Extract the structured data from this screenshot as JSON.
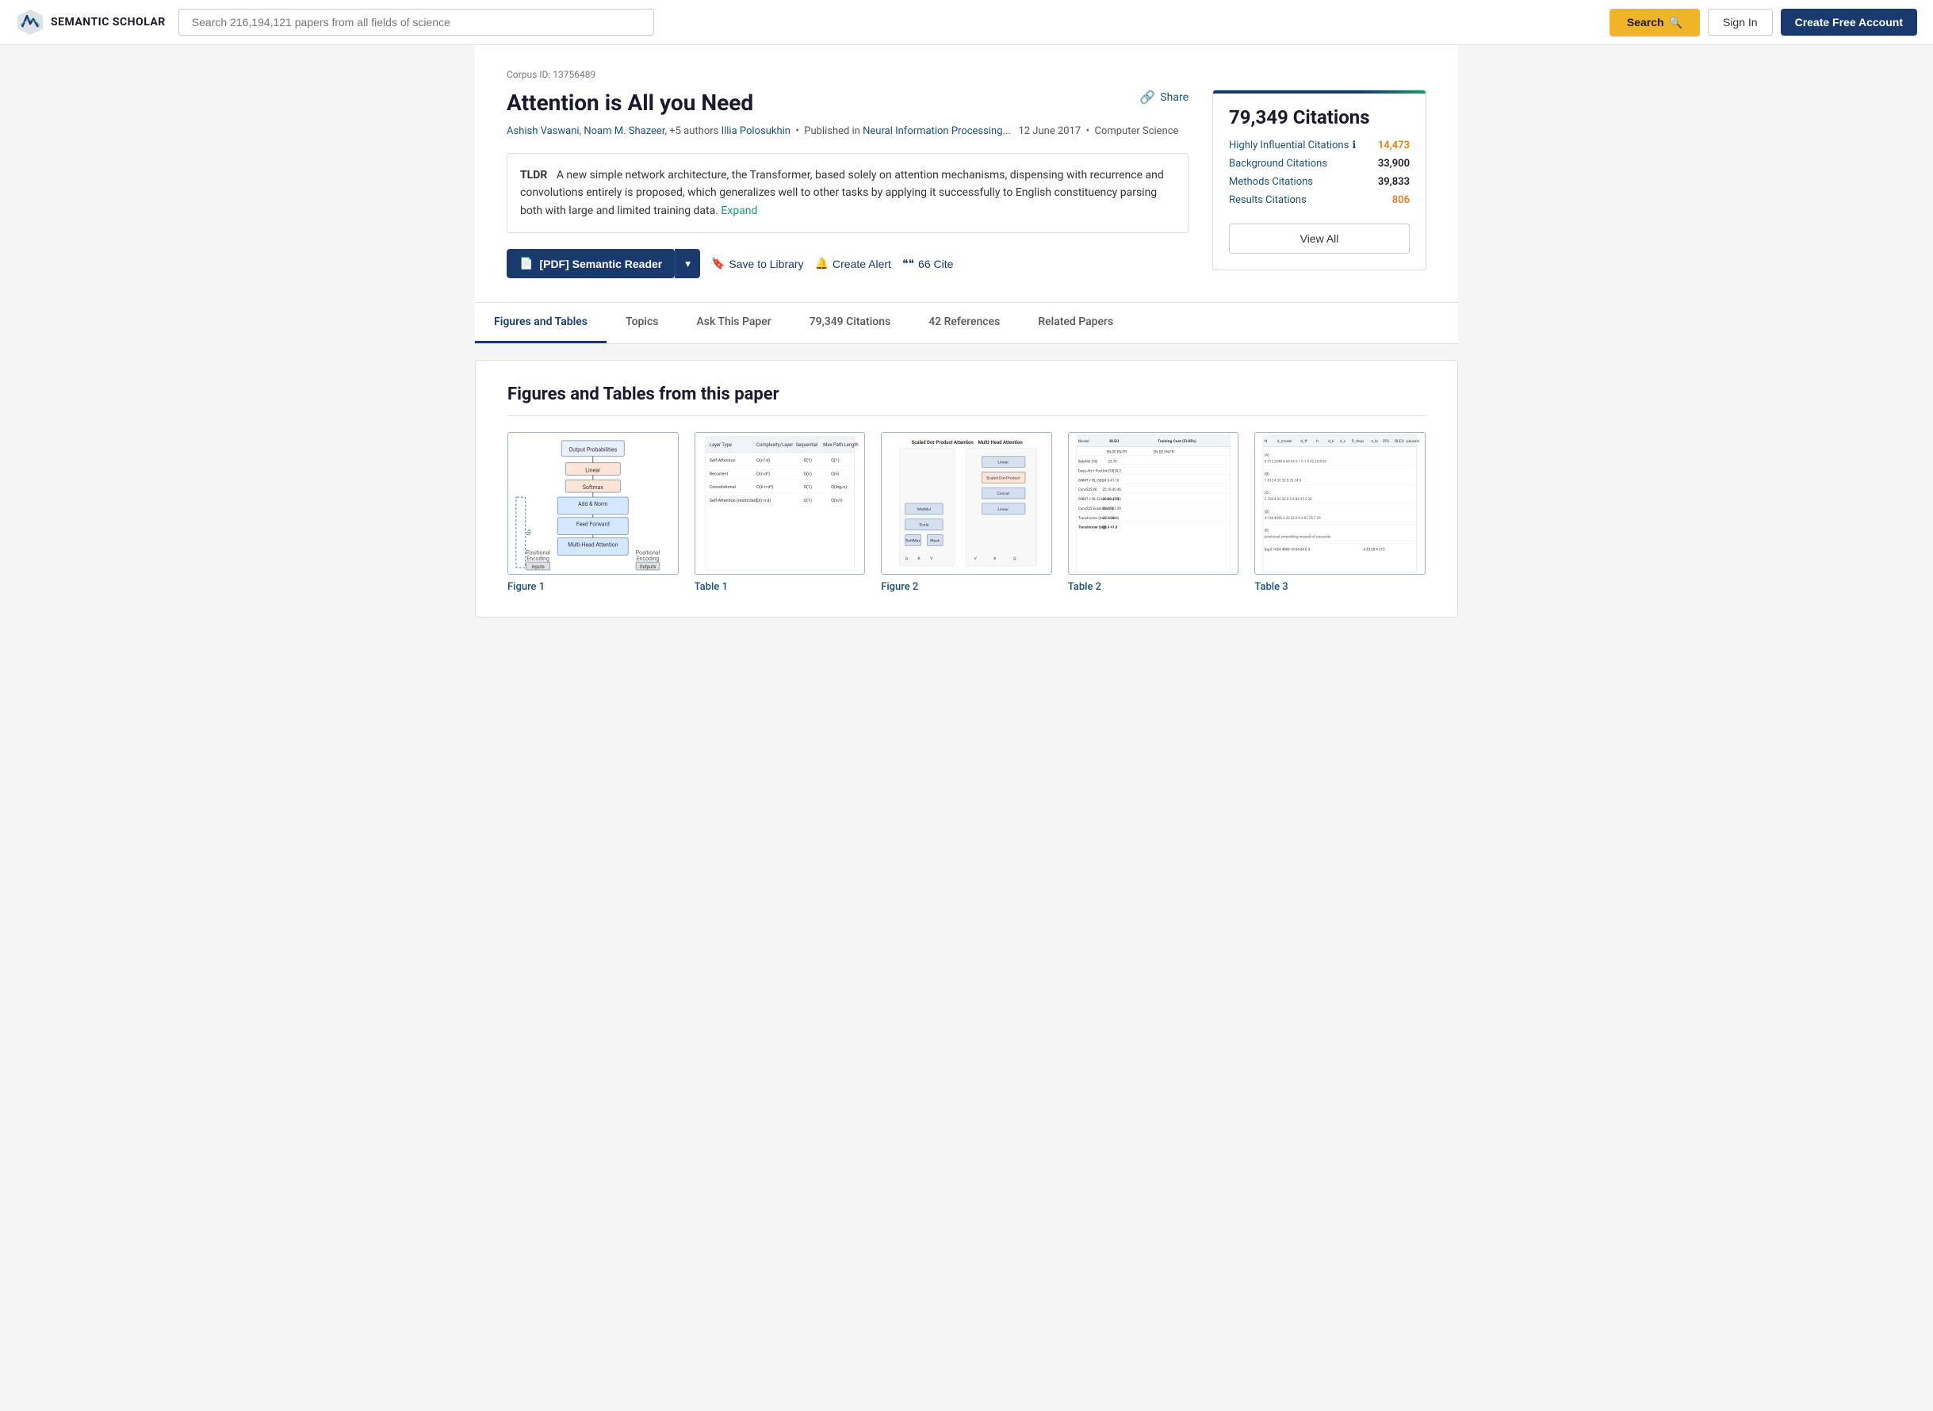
{
  "header": {
    "logo_text": "SEMANTIC SCHOLAR",
    "search_placeholder": "Search 216,194,121 papers from all fields of science",
    "search_label": "Search",
    "signin_label": "Sign In",
    "create_account_label": "Create Free Account"
  },
  "paper": {
    "corpus_id": "Corpus ID: 13756489",
    "title": "Attention is All you Need",
    "authors": [
      {
        "name": "Ashish Vaswani",
        "link": true
      },
      {
        "name": "Noam M. Shazeer",
        "link": true
      },
      {
        "name": "+5 authors",
        "link": false
      },
      {
        "name": "Illia Polosukhin",
        "link": true
      }
    ],
    "published_prefix": "Published in",
    "venue": "Neural Information Processing...",
    "date": "12 June 2017",
    "field": "Computer Science",
    "abstract": "A new simple network architecture, the Transformer, based solely on attention mechanisms, dispensing with recurrence and convolutions entirely is proposed, which generalizes well to other tasks by applying it successfully to English constituency parsing both with large and limited training data.",
    "expand_label": "Expand",
    "share_label": "Share",
    "pdf_label": "[PDF] Semantic Reader",
    "save_label": "Save to Library",
    "alert_label": "Create Alert",
    "cite_label": "66 Cite"
  },
  "citations_card": {
    "total": "79,349 Citations",
    "rows": [
      {
        "label": "Highly Influential Citations",
        "value": "14,473",
        "style": "orange"
      },
      {
        "label": "Background Citations",
        "value": "33,900",
        "style": "dark"
      },
      {
        "label": "Methods Citations",
        "value": "39,833",
        "style": "dark"
      },
      {
        "label": "Results Citations",
        "value": "806",
        "style": "orange"
      }
    ],
    "view_all_label": "View All"
  },
  "tabs": [
    {
      "label": "Figures and Tables",
      "active": true
    },
    {
      "label": "Topics",
      "active": false
    },
    {
      "label": "Ask This Paper",
      "active": false
    },
    {
      "label": "79,349 Citations",
      "active": false
    },
    {
      "label": "42 References",
      "active": false
    },
    {
      "label": "Related Papers",
      "active": false
    }
  ],
  "figures_section": {
    "title": "Figures and Tables from this paper",
    "items": [
      {
        "label": "Figure 1"
      },
      {
        "label": "Table 1"
      },
      {
        "label": "Figure 2"
      },
      {
        "label": "Table 2"
      },
      {
        "label": "Table 3"
      }
    ]
  }
}
